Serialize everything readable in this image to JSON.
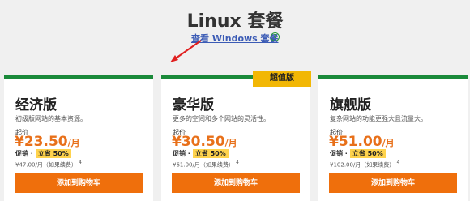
{
  "header": {
    "title": "Linux 套餐",
    "windows_link": "查看 Windows 套餐",
    "help_glyph": "?"
  },
  "plans": [
    {
      "name": "经济版",
      "desc": "初级版网站的基本资源。",
      "start_label": "起价",
      "price": "¥23.50",
      "unit": "/月",
      "promo": "促销 ·",
      "save": "立省 50%",
      "original": "¥47.00/月（如果续费）",
      "footnote": "4",
      "button": "添加到购物车"
    },
    {
      "name": "豪华版",
      "desc": "更多的空间和多个网站的灵活性。",
      "start_label": "起价",
      "price": "¥30.50",
      "unit": "/月",
      "promo": "促销 ·",
      "save": "立省 50%",
      "original": "¥61.00/月（如果续费）",
      "footnote": "4",
      "button": "添加到购物车",
      "badge": "超值版"
    },
    {
      "name": "旗舰版",
      "desc": "复杂网站的功能更强大且流量大。",
      "start_label": "起价",
      "price": "¥51.00",
      "unit": "/月",
      "promo": "促销 ·",
      "save": "立省 50%",
      "original": "¥102.00/月（如果续费）",
      "footnote": "4",
      "button": "添加到购物车"
    }
  ],
  "colors": {
    "accent": "#ef6f0c",
    "card_border": "#1a8a3a",
    "badge": "#f2b705",
    "link": "#3b5bb5"
  }
}
